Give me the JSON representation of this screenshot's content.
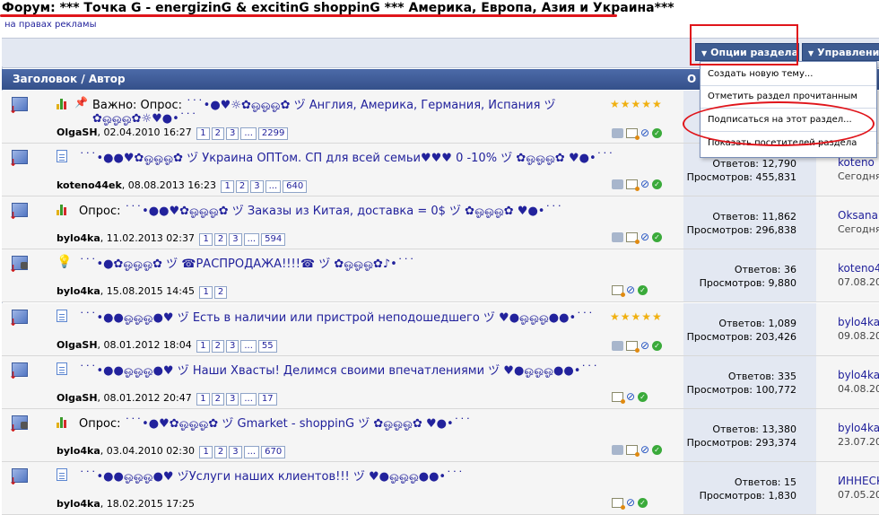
{
  "header": {
    "forum_prefix": "Форум:",
    "forum_name": "*** Точка G - energizinG & excitinG shoppinG *** Америка, Европа, Азия и Украина***",
    "ad_link": "на правах рекламы"
  },
  "controls": {
    "section_options": "Опции раздела",
    "management": "Управление"
  },
  "table_header": {
    "title_author": "Заголовок / Автор",
    "right_partial": "О"
  },
  "dropdown": {
    "items": [
      "Создать новую тему...",
      "Отметить раздел прочитанным",
      "Подписаться на этот раздел...",
      "Показать посетителей раздела"
    ]
  },
  "threads": [
    {
      "prefix": "Важно: Опрос:",
      "title": " ˙˙˙•●♥☼✿ஓஓஓ✿ ヅ Англия, Америка, Германия, Испания ヅ ✿ஓஓஓ✿☼♥●•˙˙˙",
      "author": "OlgaSH",
      "date": "02.04.2010 16:27",
      "pages": [
        "1",
        "2",
        "3",
        "...",
        "2299"
      ],
      "answers": "",
      "views": "",
      "last_user": "",
      "last_date": ""
    },
    {
      "prefix": "",
      "title": "˙˙˙•●●♥✿ஓஓஓ✿ ヅ Украина ОПТом. СП для всей семьи♥♥♥ 0 -10% ヅ ✿ஓஓஓ✿ ♥●•˙˙˙",
      "author": "koteno44ek",
      "date": "08.08.2013 16:23",
      "pages": [
        "1",
        "2",
        "3",
        "...",
        "640"
      ],
      "answers": "Ответов: 12,790",
      "views": "Просмотров: 455,831",
      "last_user": "koteno",
      "last_date": "Сегодня"
    },
    {
      "prefix": "Опрос:",
      "title": " ˙˙˙•●●♥✿ஓஓஓ✿ ヅ Заказы из Китая, доставка = 0$ ヅ ✿ஓஓஓ✿ ♥●•˙˙˙",
      "author": "bylo4ka",
      "date": "11.02.2013 02:37",
      "pages": [
        "1",
        "2",
        "3",
        "...",
        "594"
      ],
      "answers": "Ответов: 11,862",
      "views": "Просмотров: 296,838",
      "last_user": "OksanaB",
      "last_date": "Сегодня"
    },
    {
      "prefix": "",
      "title": "˙˙˙•●✿ஓஓஓ✿ ヅ ☎РАСПРОДАЖА!!!!☎ ヅ ✿ஓஓஓ✿♪•˙˙˙",
      "author": "bylo4ka",
      "date": "15.08.2015 14:45",
      "pages": [
        "1",
        "2"
      ],
      "answers": "Ответов: 36",
      "views": "Просмотров: 9,880",
      "last_user": "koteno4",
      "last_date": "07.08.20"
    },
    {
      "prefix": "",
      "title": "˙˙˙•●●ஓஓஓ●♥ ヅ Есть в наличии или пристрой неподошедшего ヅ ♥●ஓஓஓ●●•˙˙˙",
      "author": "OlgaSH",
      "date": "08.01.2012 18:04",
      "pages": [
        "1",
        "2",
        "3",
        "...",
        "55"
      ],
      "answers": "Ответов: 1,089",
      "views": "Просмотров: 203,426",
      "last_user": "bylo4ka",
      "last_date": "09.08.20"
    },
    {
      "prefix": "",
      "title": "˙˙˙•●●ஓஓஓ●♥ ヅ Наши Хвасты! Делимся своими впечатлениями ヅ ♥●ஓஓஓ●●•˙˙˙",
      "author": "OlgaSH",
      "date": "08.01.2012 20:47",
      "pages": [
        "1",
        "2",
        "3",
        "...",
        "17"
      ],
      "answers": "Ответов: 335",
      "views": "Просмотров: 100,772",
      "last_user": "bylo4ka",
      "last_date": "04.08.20"
    },
    {
      "prefix": "Опрос:",
      "title": " ˙˙˙•●♥✿ஓஓஓ✿ ヅ Gmarket - shoppinG ヅ ✿ஓஓஓ✿ ♥●•˙˙˙",
      "author": "bylo4ka",
      "date": "03.04.2010 02:30",
      "pages": [
        "1",
        "2",
        "3",
        "...",
        "670"
      ],
      "answers": "Ответов: 13,380",
      "views": "Просмотров: 293,374",
      "last_user": "bylo4ka",
      "last_date": "23.07.20"
    },
    {
      "prefix": "",
      "title": "˙˙˙•●●ஓஓஓ●♥ ヅУслуги наших клиентов!!! ヅ ♥●ஓஓஓ●●•˙˙˙",
      "author": "bylo4ka",
      "date": "18.02.2015 17:25",
      "pages": [],
      "answers": "Ответов: 15",
      "views": "Просмотров: 1,830",
      "last_user": "ИННЕСК",
      "last_date": "07.05.20"
    }
  ],
  "icons": {
    "thread_status": "thread-cube-icon",
    "doc": "document-icon",
    "poll": "poll-icon",
    "bulb": "lightbulb-icon",
    "pin": "pin-icon",
    "star": "star-icon",
    "tag": "tag-icon",
    "mail": "mail-icon",
    "clip": "paperclip-icon",
    "ok": "check-icon"
  },
  "colors": {
    "annotation": "#e0151b",
    "header_blue": "#3e5c92",
    "link_blue": "#22229c",
    "stats_bg": "#e3e8f2"
  }
}
